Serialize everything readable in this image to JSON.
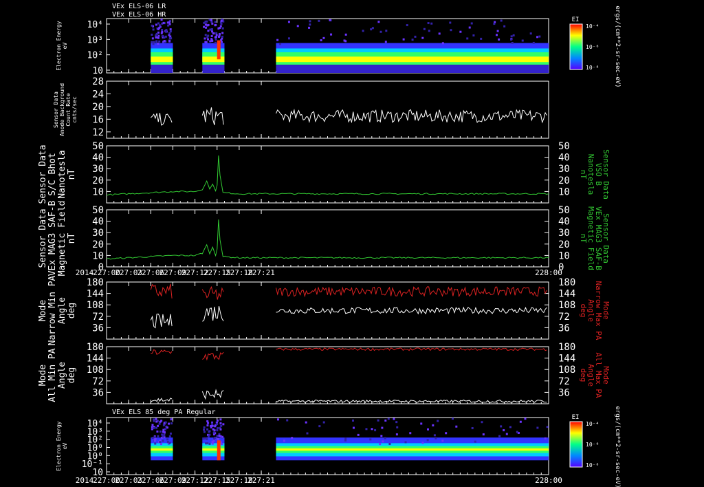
{
  "dataset_titles": [
    "VEx ELS-06 LR",
    "VEx ELS-06 HR"
  ],
  "panel7_title": "VEx ELS 85 deg PA Regular",
  "colorbar": {
    "label": "EI",
    "unit": "ergs/(cm**2-sr-sec-eV)",
    "ticks": [
      "10⁻⁴",
      "10⁻⁶",
      "10⁻⁸"
    ]
  },
  "time_axis": {
    "year": "2014",
    "ticks": [
      "227:00",
      "227:03",
      "227:06",
      "227:09",
      "227:12",
      "227:15",
      "227:18",
      "227:21",
      "228:00"
    ]
  },
  "colors": {
    "background": "#000000",
    "axes": "#ffffff",
    "mag": "#33cc33",
    "max_pa": "#dd2222",
    "min_pa": "#ffffff"
  },
  "chart_data": [
    {
      "type": "heatmap",
      "ylabel": [
        "Electron Energy",
        "eV"
      ],
      "log_y": true,
      "y_tick_labels": [
        "10⁴",
        "10³",
        "10²",
        "10"
      ],
      "data_intervals": [
        [
          "227:06",
          "227:09"
        ],
        [
          "227:13",
          "227:16"
        ],
        [
          "227:23",
          "228:00"
        ]
      ]
    },
    {
      "type": "line",
      "ylabel": [
        "Sensor Data",
        "Anode Background",
        "Count Rate",
        "cnts/sec"
      ],
      "y_ticks": [
        12,
        16,
        20,
        24,
        28
      ],
      "ylim": [
        10,
        28
      ],
      "series": [
        {
          "color": "white",
          "segments": [
            {
              "start": "227:06",
              "end": "227:09",
              "mean": 16,
              "amp": 2
            },
            {
              "start": "227:13",
              "end": "227:16",
              "mean": 17,
              "amp": 3
            },
            {
              "start": "227:23",
              "end": "228:00",
              "mean": 17,
              "amp": 2
            }
          ]
        }
      ]
    },
    {
      "type": "line",
      "ylabel": [
        "Sensor Data",
        "S/C Bhot",
        "Nanotesla",
        "nT"
      ],
      "right_label": [
        "Sensor Data",
        "VSO B",
        "Nanotesla",
        "nT"
      ],
      "y_ticks": [
        10,
        20,
        30,
        40,
        50
      ],
      "ylim": [
        0,
        50
      ],
      "series": [
        {
          "color": "green",
          "points": [
            [
              "227:00",
              7
            ],
            [
              "227:03",
              8
            ],
            [
              "227:06",
              9
            ],
            [
              "227:09",
              10
            ],
            [
              "227:12",
              10
            ],
            [
              "227:13",
              12
            ],
            [
              "227:13.6",
              19
            ],
            [
              "227:14",
              12
            ],
            [
              "227:14.4",
              17
            ],
            [
              "227:14.8",
              10
            ],
            [
              "227:15",
              16
            ],
            [
              "227:15.2",
              42
            ],
            [
              "227:15.4",
              24
            ],
            [
              "227:15.8",
              9
            ],
            [
              "227:18",
              8
            ],
            [
              "227:21",
              8
            ],
            [
              "228:00",
              8
            ]
          ]
        }
      ]
    },
    {
      "type": "line",
      "ylabel": [
        "Sensor Data",
        "VEx MAG3 SAF-B",
        "Magnetic Field",
        "nT"
      ],
      "right_label": [
        "Sensor Data",
        "VEx MAG3 SAF-B",
        "Magnetic Field",
        "nT"
      ],
      "y_ticks": [
        0,
        10,
        20,
        30,
        40,
        50
      ],
      "ylim": [
        0,
        50
      ],
      "series": [
        {
          "color": "green",
          "points": [
            [
              "227:00",
              7
            ],
            [
              "227:03",
              8
            ],
            [
              "227:06",
              9
            ],
            [
              "227:09",
              10
            ],
            [
              "227:12",
              10
            ],
            [
              "227:13",
              12
            ],
            [
              "227:13.6",
              19
            ],
            [
              "227:14",
              12
            ],
            [
              "227:14.4",
              17
            ],
            [
              "227:14.8",
              10
            ],
            [
              "227:15",
              16
            ],
            [
              "227:15.2",
              42
            ],
            [
              "227:15.4",
              24
            ],
            [
              "227:15.8",
              9
            ],
            [
              "227:18",
              8
            ],
            [
              "227:21",
              8
            ],
            [
              "228:00",
              8
            ]
          ]
        }
      ]
    },
    {
      "type": "line",
      "ylabel": [
        "Mode",
        "Narrow Min PA",
        "Angle",
        "deg"
      ],
      "right_label": [
        "Mode",
        "Narrow Max PA",
        "Angle",
        "deg"
      ],
      "y_ticks": [
        36,
        72,
        108,
        144,
        180
      ],
      "ylim": [
        0,
        180
      ],
      "series": [
        {
          "color": "red",
          "segments": [
            {
              "start": "227:06",
              "end": "227:09",
              "mean": 150,
              "amp": 25
            },
            {
              "start": "227:13",
              "end": "227:16",
              "mean": 140,
              "amp": 25
            },
            {
              "start": "227:23",
              "end": "228:00",
              "mean": 150,
              "amp": 15
            }
          ]
        },
        {
          "color": "white",
          "segments": [
            {
              "start": "227:06",
              "end": "227:09",
              "mean": 55,
              "amp": 25
            },
            {
              "start": "227:13",
              "end": "227:16",
              "mean": 85,
              "amp": 30
            },
            {
              "start": "227:23",
              "end": "228:00",
              "mean": 90,
              "amp": 10
            }
          ]
        }
      ]
    },
    {
      "type": "line",
      "ylabel": [
        "Mode",
        "All Min PA",
        "Angle",
        "deg"
      ],
      "right_label": [
        "Mode",
        "All Max PA",
        "Angle",
        "deg"
      ],
      "y_ticks": [
        36,
        72,
        108,
        144,
        180
      ],
      "ylim": [
        0,
        180
      ],
      "series": [
        {
          "color": "red",
          "segments": [
            {
              "start": "227:06",
              "end": "227:09",
              "mean": 162,
              "amp": 10
            },
            {
              "start": "227:13",
              "end": "227:16",
              "mean": 150,
              "amp": 15
            },
            {
              "start": "227:23",
              "end": "228:00",
              "mean": 172,
              "amp": 4
            }
          ]
        },
        {
          "color": "white",
          "segments": [
            {
              "start": "227:06",
              "end": "227:09",
              "mean": 12,
              "amp": 8
            },
            {
              "start": "227:13",
              "end": "227:16",
              "mean": 30,
              "amp": 15
            },
            {
              "start": "227:23",
              "end": "228:00",
              "mean": 8,
              "amp": 4
            }
          ]
        }
      ]
    },
    {
      "type": "heatmap",
      "ylabel": [
        "Electron Energy",
        "eV"
      ],
      "log_y": true,
      "y_tick_labels": [
        "10⁴",
        "10³",
        "10²",
        "10⁰",
        "10⁰",
        "10⁻¹",
        "10"
      ],
      "data_intervals": [
        [
          "227:06",
          "227:09"
        ],
        [
          "227:13",
          "227:16"
        ],
        [
          "227:23",
          "228:00"
        ]
      ]
    }
  ]
}
